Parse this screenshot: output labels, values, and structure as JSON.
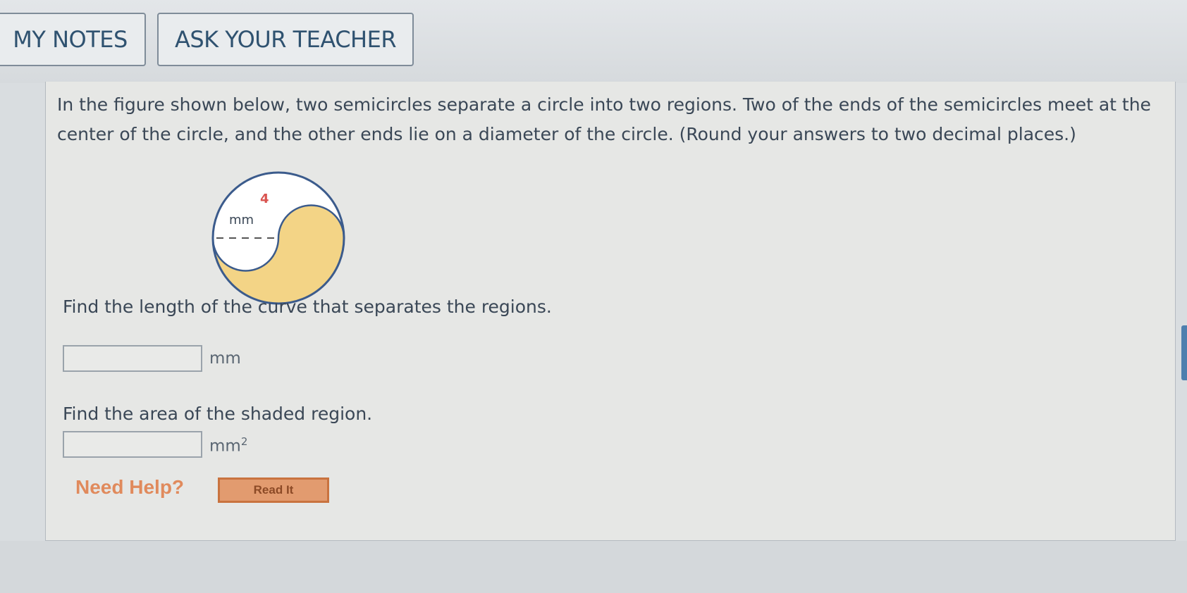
{
  "toolbar": {
    "my_notes_label": "MY NOTES",
    "ask_teacher_label": "ASK YOUR TEACHER"
  },
  "question": {
    "text": "In the figure shown below, two semicircles separate a circle into two regions. Two of the ends of the semicircles meet at the center of the circle, and the other ends lie on a diameter of the circle. (Round your answers to two decimal places.)"
  },
  "figure": {
    "radius_value": "4",
    "radius_unit": "mm",
    "shade_color": "#f3d486",
    "outline_color": "#3b5b8c",
    "label_color": "#d9534f"
  },
  "parts": [
    {
      "prompt": "Find the length of the curve that separates the regions.",
      "value": "",
      "unit": "mm"
    },
    {
      "prompt": "Find the area of the shaded region.",
      "value": "",
      "unit": "mm",
      "unit_exponent": "2"
    }
  ],
  "help": {
    "label": "Need Help?",
    "read_button": "Read It"
  }
}
